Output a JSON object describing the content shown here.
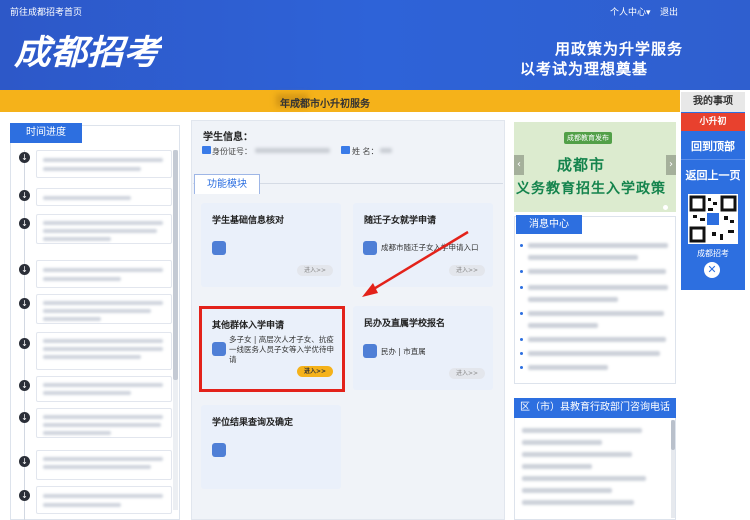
{
  "topbar": {
    "home_link": "前往成都招考首页",
    "user_menu": "个人中心",
    "user_menu_caret": "▾",
    "logout": "退出"
  },
  "header": {
    "logo_text": "成都招考",
    "slogan_line1": "用政策为升学服务",
    "slogan_line2": "以考试为理想奠基",
    "bg_color": "#2f5fcf"
  },
  "band": {
    "title": "年成都市小升初服务",
    "color": "#f5b21a"
  },
  "side_nav": {
    "title": "我的事项",
    "tag": "小升初",
    "back_to_top": "回到顶部",
    "back_prev": "返回上一页",
    "qr_label": "成都招考",
    "close_glyph": "✕"
  },
  "progress": {
    "tab": "时间进度",
    "item_count_note": ""
  },
  "student": {
    "title": "学生信息：",
    "id_label": "身份证号：",
    "name_label": "姓 名："
  },
  "modules": {
    "tab": "功能模块",
    "cards": [
      {
        "title": "学生基础信息核对",
        "desc": "",
        "enter": "进入>>"
      },
      {
        "title": "随迁子女就学申请",
        "desc": "成都市随迁子女入学申请入口",
        "enter": "进入>>"
      },
      {
        "title": "其他群体入学申请",
        "desc": "多子女 | 高层次人才子女、抗疫一线医务人员子女等入学优待申请",
        "enter": "进入>>"
      },
      {
        "title": "民办及直属学校报名",
        "desc": "民办 | 市直属",
        "enter": "进入>>"
      },
      {
        "title": "学位结果查询及确定",
        "desc": "",
        "enter": ""
      }
    ]
  },
  "banner": {
    "org": "成都教育发布",
    "line1": "成都市",
    "line2": "义务教育招生入学政策",
    "prev": "‹",
    "next": "›"
  },
  "news": {
    "tab": "消息中心"
  },
  "contact": {
    "title": "区（市）县教育行政部门咨询电话"
  },
  "colors": {
    "accent": "#2d6fe0",
    "highlight": "#e3221a",
    "yellow": "#f5b21a"
  }
}
